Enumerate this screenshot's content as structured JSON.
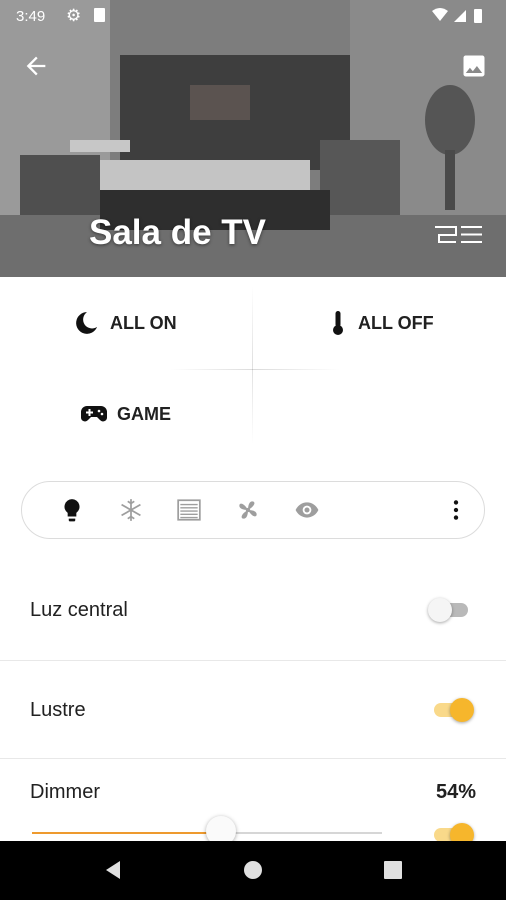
{
  "status_bar": {
    "time": "3:49"
  },
  "header": {
    "title": "Sala de TV"
  },
  "scenes": [
    {
      "label": "ALL ON",
      "icon": "moon-icon"
    },
    {
      "label": "ALL OFF",
      "icon": "thermometer-icon"
    },
    {
      "label": "GAME",
      "icon": "gamepad-icon"
    }
  ],
  "filters": [
    "lightbulb-icon",
    "snowflake-icon",
    "shutter-icon",
    "fan-icon",
    "eye-icon",
    "more-vert-icon"
  ],
  "devices": [
    {
      "label": "Luz central",
      "on": false
    },
    {
      "label": "Lustre",
      "on": true
    },
    {
      "label": "Dimmer",
      "value_text": "54%",
      "level": 0.54,
      "on": true
    }
  ],
  "colors": {
    "accent": "#f6b62c",
    "slider": "#ee9a2e"
  }
}
